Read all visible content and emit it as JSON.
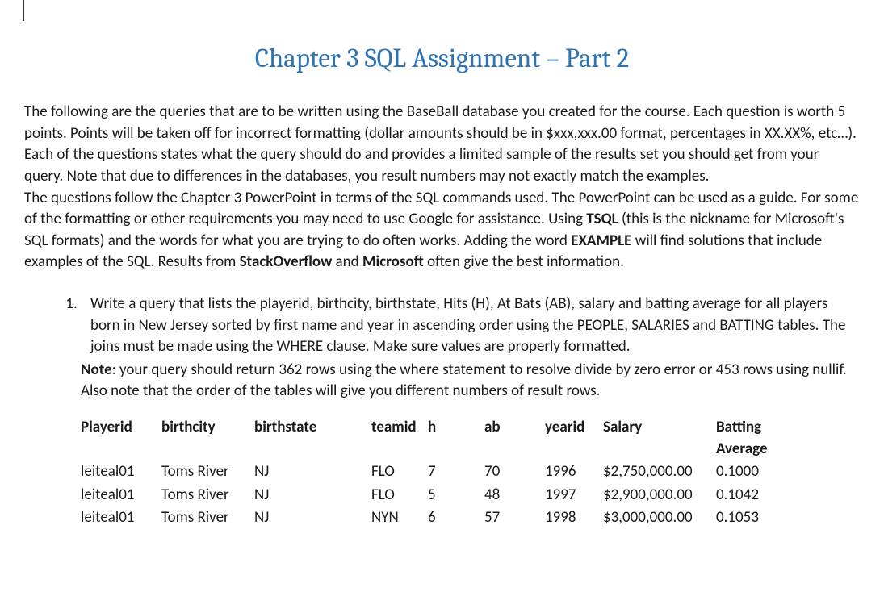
{
  "title": "Chapter 3 SQL Assignment – Part 2",
  "para1_a": "The following are the queries that are to be written using the BaseBall database you created for the course. Each question is worth 5 points. Points will be taken off for incorrect formatting (dollar amounts should be in $xxx,xxx.00 format, percentages in XX.XX%,  etc…). Each of the questions states what the query should do and provides a limited sample of the results set you should get from your query. Note that due to differences in the databases, you result numbers may not exactly match the examples.",
  "para2_a": "The questions follow the Chapter 3 PowerPoint in terms of the SQL commands used. The PowerPoint can be used as a guide. For some of the formatting or other requirements you may need to use Google for assistance. Using ",
  "para2_tsql": "TSQL",
  "para2_b": " (this is the nickname for Microsoft's SQL formats)  and the words for what you are trying to do often works. Adding the word ",
  "para2_example": "EXAMPLE",
  "para2_c": " will find solutions that include examples of the SQL. Results from ",
  "para2_so": "StackOverflow",
  "para2_and": " and ",
  "para2_ms": "Microsoft",
  "para2_d": " often give the best information.",
  "q1": "Write a query that lists the playerid, birthcity, birthstate, Hits (H), At Bats (AB), salary and batting average for all players born in New Jersey sorted by first name and year in ascending order using the PEOPLE, SALARIES and BATTING tables. The joins must be made using the WHERE clause. Make sure values are properly formatted.",
  "note_label": "Note",
  "note_text": ": your query should return 362 rows using the where statement to resolve divide by zero error or 453 rows using nullif. Also note that the order of the tables will give you different numbers of result rows.",
  "table": {
    "headers": [
      "Playerid",
      "birthcity",
      "birthstate",
      "teamid",
      "h",
      "ab",
      "yearid",
      "Salary",
      "Batting Average"
    ],
    "rows": [
      [
        "leiteal01",
        "Toms River",
        "NJ",
        "FLO",
        "7",
        "70",
        "1996",
        "$2,750,000.00",
        "0.1000"
      ],
      [
        "leiteal01",
        "Toms River",
        "NJ",
        "FLO",
        "5",
        "48",
        "1997",
        "$2,900,000.00",
        "0.1042"
      ],
      [
        "leiteal01",
        "Toms River",
        "NJ",
        "NYN",
        "6",
        "57",
        "1998",
        "$3,000,000.00",
        "0.1053"
      ]
    ]
  }
}
